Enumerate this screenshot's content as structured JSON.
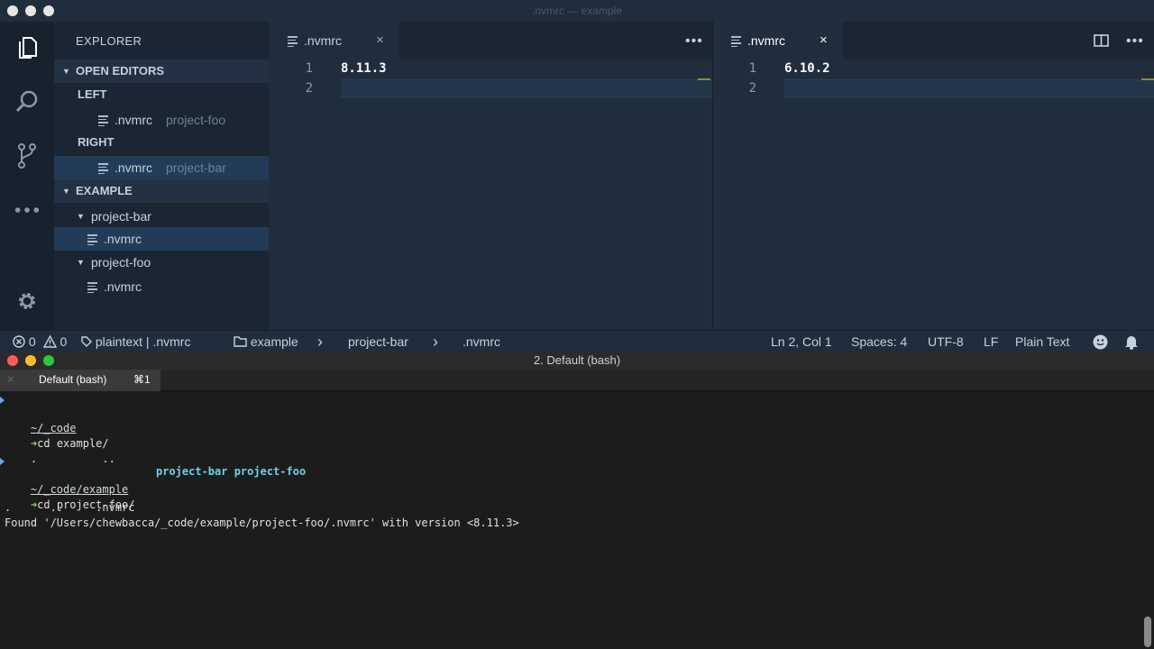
{
  "window": {
    "title": ".nvmrc — example"
  },
  "activity": {
    "icons": [
      "files-icon",
      "search-icon",
      "source-control-icon",
      "more-icon",
      "gear-icon"
    ]
  },
  "sidebar": {
    "header": "EXPLORER",
    "open_editors": {
      "label": "OPEN EDITORS",
      "groups": [
        {
          "label": "LEFT",
          "file": ".nvmrc",
          "folder": "project-foo"
        },
        {
          "label": "RIGHT",
          "file": ".nvmrc",
          "folder": "project-bar"
        }
      ]
    },
    "workspace": {
      "label": "EXAMPLE",
      "folders": [
        {
          "name": "project-bar",
          "file": ".nvmrc"
        },
        {
          "name": "project-foo",
          "file": ".nvmrc"
        }
      ]
    }
  },
  "editors": {
    "left": {
      "tab": ".nvmrc",
      "close": "×",
      "more": "•••",
      "lines": [
        {
          "n": "1",
          "text": "8.11.3"
        },
        {
          "n": "2",
          "text": ""
        }
      ]
    },
    "right": {
      "tab": ".nvmrc",
      "close": "×",
      "more": "•••",
      "lines": [
        {
          "n": "1",
          "text": "6.10.2"
        },
        {
          "n": "2",
          "text": ""
        }
      ]
    }
  },
  "statusbar": {
    "errors": "0",
    "warnings": "0",
    "language_file": "plaintext | .nvmrc",
    "breadcrumbs": [
      "example",
      "project-bar",
      ".nvmrc"
    ],
    "separator": "›",
    "position": "Ln 2, Col 1",
    "spaces": "Spaces: 4",
    "encoding": "UTF-8",
    "eol": "LF",
    "mode": "Plain Text"
  },
  "terminal": {
    "title": "2. Default (bash)",
    "tab": {
      "label": "Default (bash)",
      "shortcut": "⌘1",
      "close": "×"
    },
    "lines": [
      {
        "kind": "path",
        "text": "~/_code"
      },
      {
        "kind": "cmd",
        "arrow": "➜",
        "text": "cd example/"
      },
      {
        "kind": "ls",
        "dots": ".          ..",
        "dirs": "project-bar project-foo"
      },
      {
        "kind": "path",
        "text": "~/_code/example"
      },
      {
        "kind": "cmd",
        "arrow": "➜",
        "text": "cd project-foo/"
      },
      {
        "kind": "plain",
        "text": ".      ..     .nvmrc"
      },
      {
        "kind": "plain",
        "text": "Found '/Users/chewbacca/_code/example/project-foo/.nvmrc' with version <8.11.3>"
      }
    ]
  },
  "colors": {
    "editor_bg": "#1f2d3d",
    "sidebar_bg": "#1a2633",
    "terminal_bg": "#1c1c1c",
    "prompt_arrow": "#8ee03b",
    "dir_color": "#6fd0e8"
  }
}
